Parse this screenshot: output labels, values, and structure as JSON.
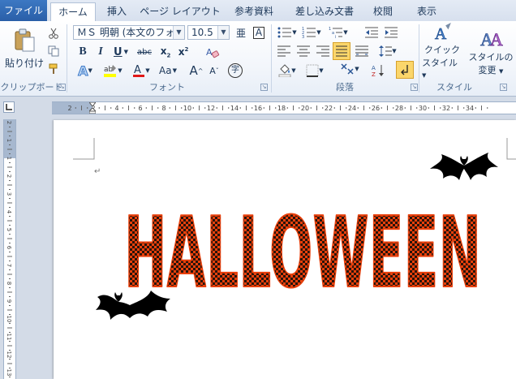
{
  "tabs": [
    {
      "label": "ファイル"
    },
    {
      "label": "ホーム"
    },
    {
      "label": "挿入"
    },
    {
      "label": "ページ レイアウト"
    },
    {
      "label": "参考資料"
    },
    {
      "label": "差し込み文書"
    },
    {
      "label": "校閲"
    },
    {
      "label": "表示"
    }
  ],
  "clipboard": {
    "paste_label": "貼り付け",
    "group_label": "クリップボード"
  },
  "font": {
    "name": "ＭＳ 明朝 (本文のフォン",
    "size": "10.5",
    "group_label": "フォント",
    "bold": "B",
    "italic": "I",
    "underline": "U",
    "strike": "abc",
    "subscript": "x",
    "superscript": "x",
    "case": "Aa",
    "grow": "A",
    "shrink": "A",
    "clear": "A",
    "enclose": "字",
    "phonetic": "亜",
    "box": "A"
  },
  "paragraph": {
    "group_label": "段落"
  },
  "styles": {
    "quick_label_1": "クイック",
    "quick_label_2": "スタイル",
    "change_label_1": "スタイルの",
    "change_label_2": "変更",
    "group_label": "スタイル"
  },
  "ruler": {
    "labels": [
      "2",
      "2",
      "4",
      "6",
      "8",
      "10",
      "12",
      "14",
      "16",
      "18",
      "20",
      "22",
      "24",
      "26",
      "28",
      "30",
      "32",
      "34"
    ],
    "vlabels": [
      "2",
      "1",
      "1",
      "2",
      "3",
      "4",
      "5",
      "6",
      "7",
      "8",
      "9",
      "10",
      "11",
      "12",
      "13"
    ]
  },
  "document": {
    "title_text": "HALLOWEEN",
    "paragraph_mark": "↵"
  },
  "colors": {
    "accent": "#2a5fa8",
    "halloween_fill": "#e8400c",
    "halloween_check": "#2a140a"
  }
}
